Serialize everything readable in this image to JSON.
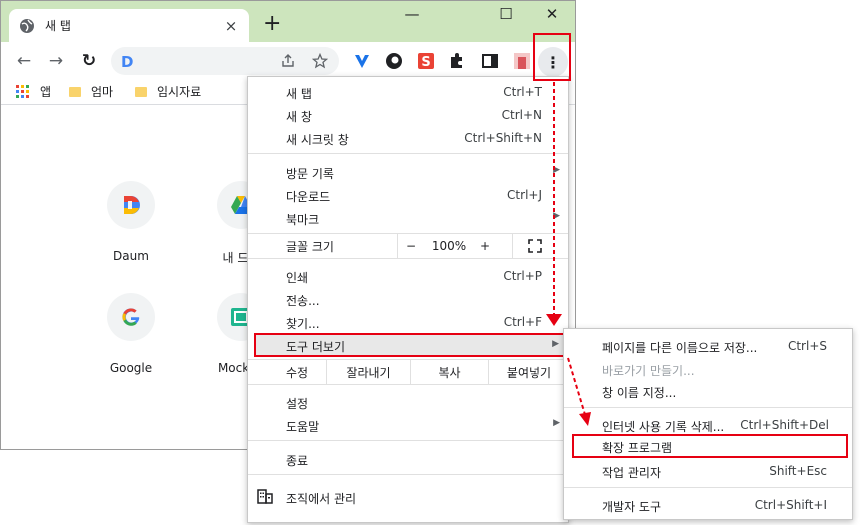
{
  "tab": {
    "title": "새 탭",
    "close": "×"
  },
  "titlebar": {
    "new_tab": "+",
    "minimize": "—",
    "maximize": "☐",
    "close": "✕"
  },
  "toolbar": {
    "back": "←",
    "forward": "→",
    "reload": "↻",
    "omnibox_letter": "D",
    "menu_icon": "⋮"
  },
  "bookmarks": {
    "apps": "앱",
    "items": [
      "엄마",
      "임시자료"
    ]
  },
  "shortcuts": [
    "Daum",
    "내 드라",
    "Google",
    "Mockup"
  ],
  "menu": {
    "new_tab": {
      "label": "새 탭",
      "shortcut": "Ctrl+T"
    },
    "new_window": {
      "label": "새 창",
      "shortcut": "Ctrl+N"
    },
    "incognito": {
      "label": "새 시크릿 창",
      "shortcut": "Ctrl+Shift+N"
    },
    "history": {
      "label": "방문 기록"
    },
    "downloads": {
      "label": "다운로드",
      "shortcut": "Ctrl+J"
    },
    "bookmarks": {
      "label": "북마크"
    },
    "zoom": {
      "label": "글꼴 크기",
      "minus": "−",
      "value": "100%",
      "plus": "+"
    },
    "print": {
      "label": "인쇄",
      "shortcut": "Ctrl+P"
    },
    "cast": {
      "label": "전송..."
    },
    "find": {
      "label": "찾기...",
      "shortcut": "Ctrl+F"
    },
    "more_tools": {
      "label": "도구 더보기"
    },
    "edit": {
      "label": "수정",
      "cut": "잘라내기",
      "copy": "복사",
      "paste": "붙여넣기"
    },
    "settings": {
      "label": "설정"
    },
    "help": {
      "label": "도움말"
    },
    "exit": {
      "label": "종료"
    },
    "managed": {
      "label": "조직에서 관리"
    }
  },
  "submenu": {
    "save_page": {
      "label": "페이지를 다른 이름으로 저장...",
      "shortcut": "Ctrl+S"
    },
    "create_shortcut": {
      "label": "바로가기 만들기..."
    },
    "name_window": {
      "label": "창 이름 지정..."
    },
    "clear_data": {
      "label": "인터넷 사용 기록 삭제...",
      "shortcut": "Ctrl+Shift+Del"
    },
    "extensions": {
      "label": "확장 프로그램"
    },
    "task_manager": {
      "label": "작업 관리자",
      "shortcut": "Shift+Esc"
    },
    "dev_tools": {
      "label": "개발자 도구",
      "shortcut": "Ctrl+Shift+I"
    }
  },
  "colors": {
    "titlebar": "#cde5bd",
    "highlight": "#e60012",
    "hover": "#e8e8e8"
  }
}
